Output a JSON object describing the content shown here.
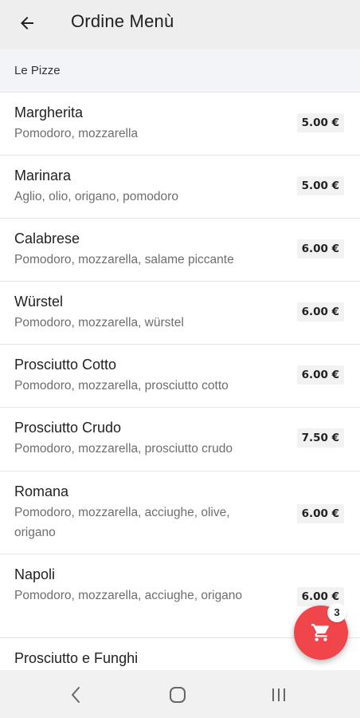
{
  "app_bar": {
    "title": "Ordine Menù",
    "back_icon": "arrow-back-icon"
  },
  "section": {
    "title": "Le Pizze"
  },
  "items": [
    {
      "name": "Margherita",
      "description": "Pomodoro, mozzarella",
      "price": "5.00 €"
    },
    {
      "name": "Marinara",
      "description": "Aglio, olio, origano, pomodoro",
      "price": "5.00 €"
    },
    {
      "name": "Calabrese",
      "description": "Pomodoro, mozzarella, salame piccante",
      "price": "6.00 €"
    },
    {
      "name": "Würstel",
      "description": "Pomodoro, mozzarella, würstel",
      "price": "6.00 €"
    },
    {
      "name": "Prosciutto Cotto",
      "description": "Pomodoro, mozzarella, prosciutto cotto",
      "price": "6.00 €"
    },
    {
      "name": "Prosciutto Crudo",
      "description": "Pomodoro, mozzarella, prosciutto crudo",
      "price": "7.50 €"
    },
    {
      "name": "Romana",
      "description": "Pomodoro, mozzarella, acciughe, olive, origano",
      "price": "6.00 €"
    },
    {
      "name": "Napoli",
      "description": "Pomodoro, mozzarella, acciughe, origano",
      "price": "6.00 €"
    },
    {
      "name": "Prosciutto e Funghi",
      "description": "",
      "price": ""
    }
  ],
  "cart": {
    "icon": "shopping-cart-icon",
    "count": "3",
    "color": "#f0454b"
  },
  "system_nav": {
    "back_icon": "nav-back-icon",
    "home_icon": "nav-home-icon",
    "recents_icon": "nav-recents-icon"
  }
}
